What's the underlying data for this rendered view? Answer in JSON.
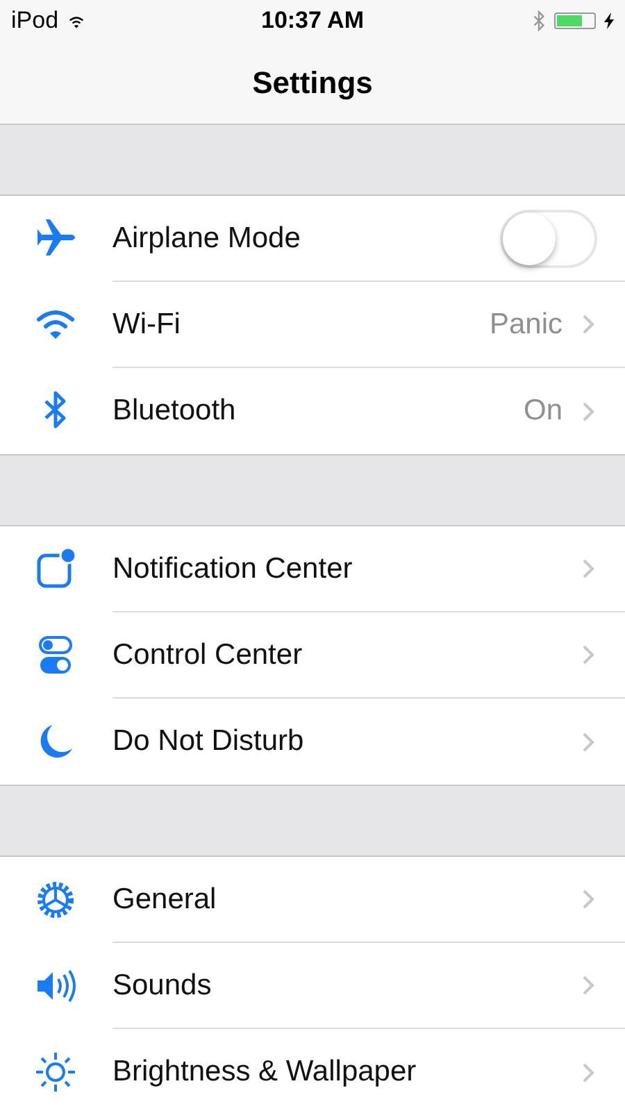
{
  "status_bar": {
    "carrier": "iPod",
    "time": "10:37 AM",
    "battery": {
      "level": 0.7
    }
  },
  "navigation_bar": {
    "title": "Settings"
  },
  "groups": [
    {
      "rows": [
        {
          "kind": "toggle",
          "label": "Airplane Mode",
          "on": false
        },
        {
          "kind": "link",
          "label": "Wi-Fi",
          "detail": "Panic"
        },
        {
          "kind": "link",
          "label": "Bluetooth",
          "detail": "On"
        }
      ]
    },
    {
      "rows": [
        {
          "kind": "link",
          "label": "Notification Center"
        },
        {
          "kind": "link",
          "label": "Control Center"
        },
        {
          "kind": "link",
          "label": "Do Not Disturb"
        }
      ]
    },
    {
      "rows": [
        {
          "kind": "link",
          "label": "General"
        },
        {
          "kind": "link",
          "label": "Sounds"
        },
        {
          "kind": "link",
          "label": "Brightness & Wallpaper"
        }
      ]
    }
  ]
}
